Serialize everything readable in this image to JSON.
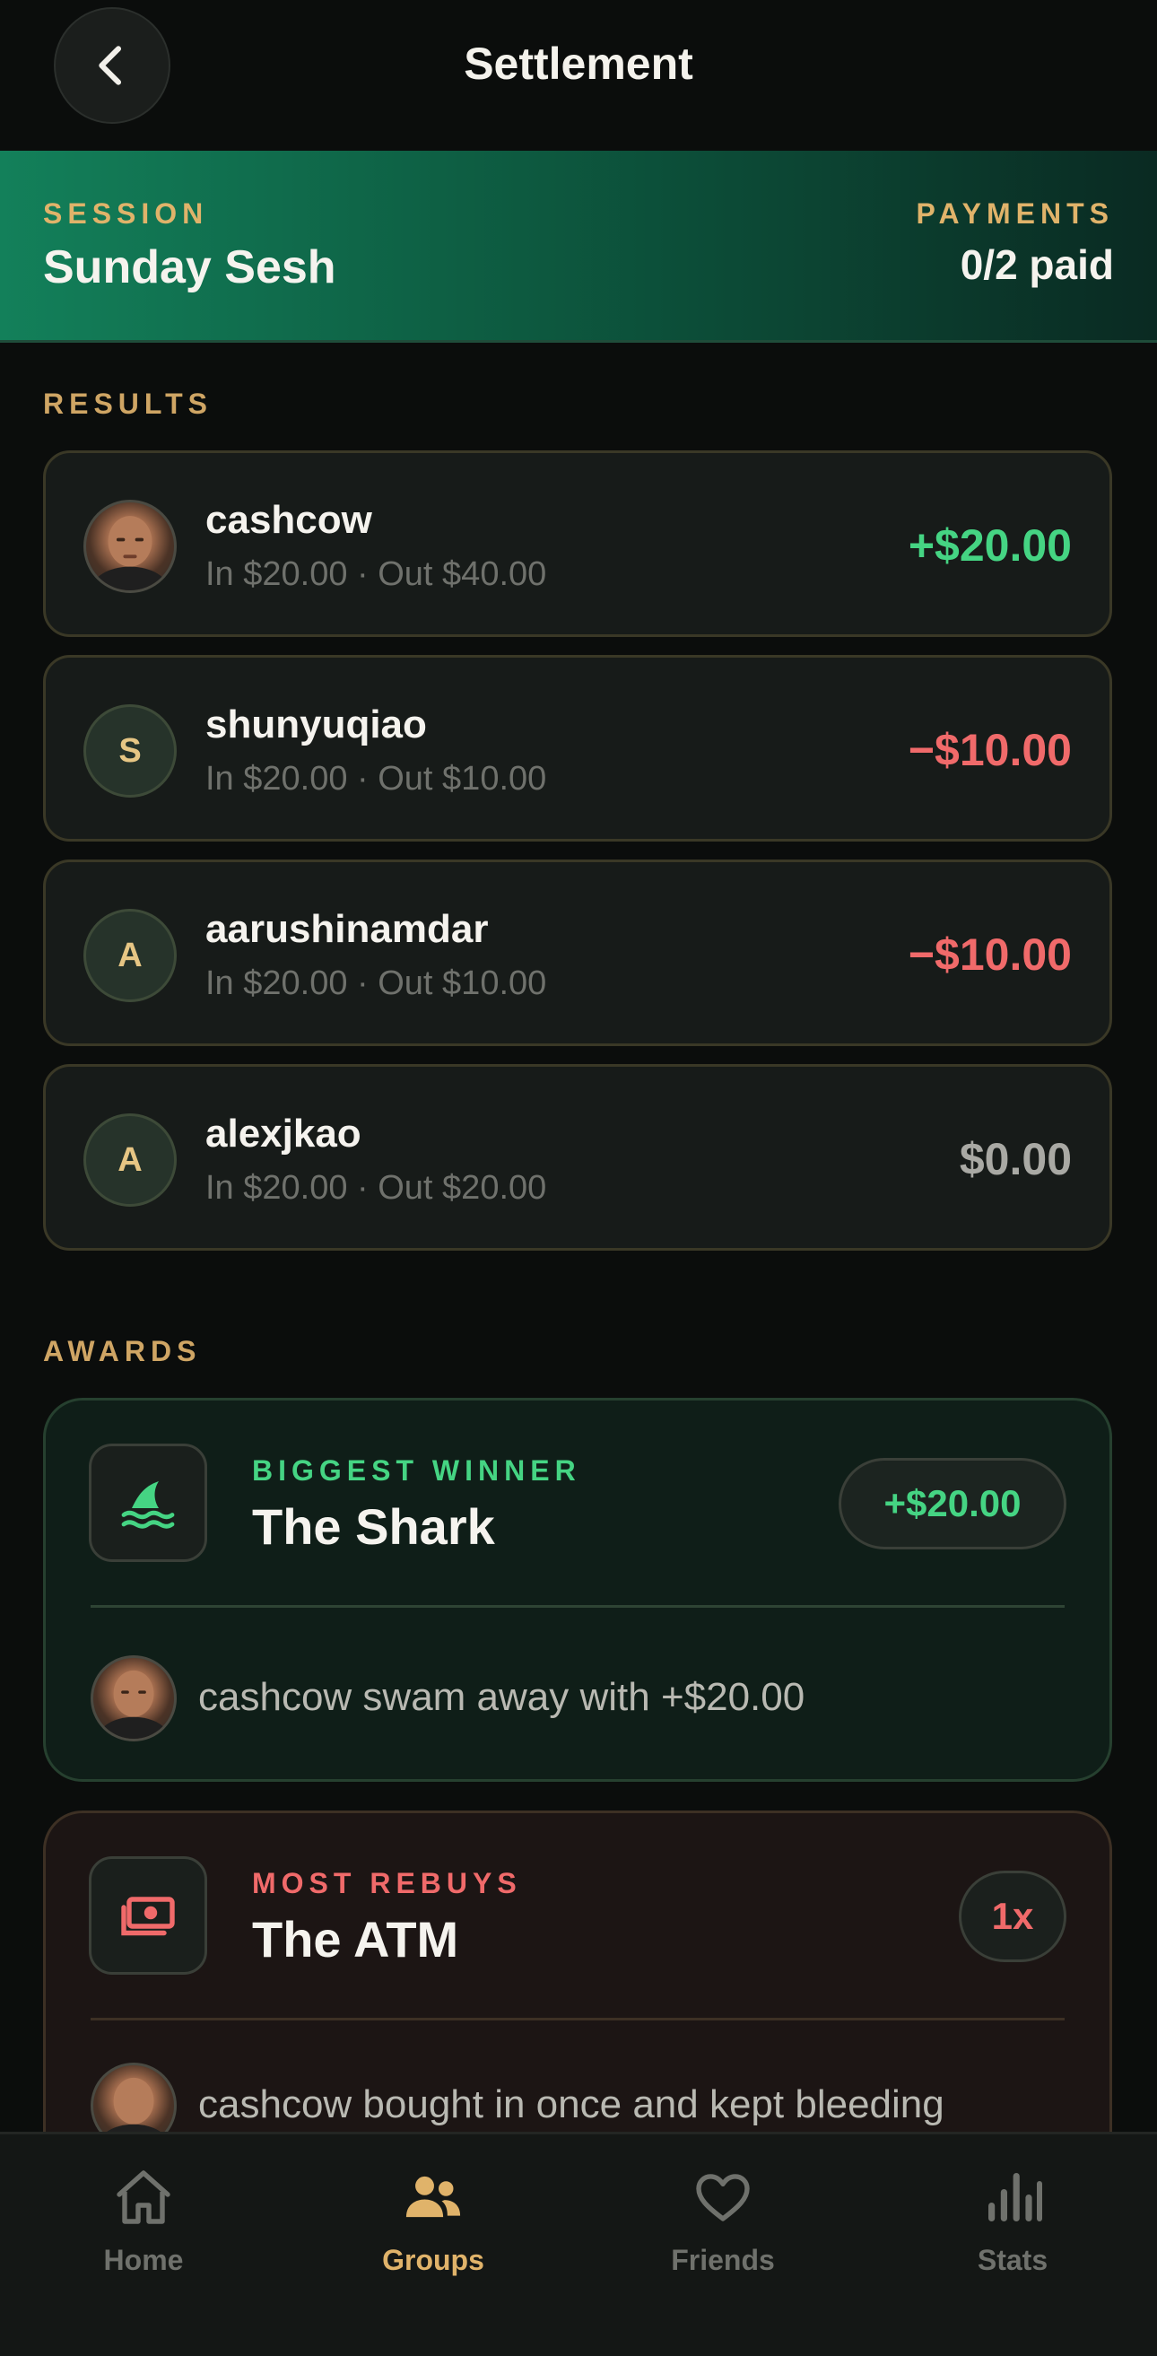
{
  "header": {
    "title": "Settlement",
    "back_icon": "chevron-left-icon"
  },
  "session": {
    "label": "SESSION",
    "name": "Sunday Sesh",
    "payments_label": "PAYMENTS",
    "payments_value": "0/2 paid"
  },
  "results": {
    "label": "RESULTS",
    "players": [
      {
        "name": "cashcow",
        "detail": "In $20.00 · Out $40.00",
        "net": "+$20.00",
        "initial": "",
        "has_photo": true,
        "net_color": "#45d483"
      },
      {
        "name": "shunyuqiao",
        "detail": "In $20.00 · Out $10.00",
        "net": "−$10.00",
        "initial": "S",
        "has_photo": false,
        "net_color": "#f06a6a"
      },
      {
        "name": "aarushinamdar",
        "detail": "In $20.00 · Out $10.00",
        "net": "−$10.00",
        "initial": "A",
        "has_photo": false,
        "net_color": "#f06a6a"
      },
      {
        "name": "alexjkao",
        "detail": "In $20.00 · Out $20.00",
        "net": "$0.00",
        "initial": "A",
        "has_photo": false,
        "net_color": "#a9a9a4"
      }
    ]
  },
  "awards": {
    "label": "AWARDS",
    "items": [
      {
        "kicker": "BIGGEST WINNER",
        "title": "The Shark",
        "badge": "+$20.00",
        "text": "cashcow swam away with +$20.00",
        "icon": "shark-fin-icon",
        "accent": "#45d483"
      },
      {
        "kicker": "MOST REBUYS",
        "title": "The ATM",
        "badge": "1x",
        "text": "cashcow bought in once and kept bleeding",
        "icon": "cash-icon",
        "accent": "#f06a6a"
      }
    ]
  },
  "tabs": [
    {
      "label": "Home",
      "icon": "home-icon",
      "active": false
    },
    {
      "label": "Groups",
      "icon": "groups-icon",
      "active": true
    },
    {
      "label": "Friends",
      "icon": "heart-icon",
      "active": false
    },
    {
      "label": "Stats",
      "icon": "bar-chart-icon",
      "active": false
    }
  ],
  "colors": {
    "accent_gold": "#e0b36a",
    "positive": "#45d483",
    "negative": "#f06a6a",
    "inactive_tab": "#6f716c"
  }
}
